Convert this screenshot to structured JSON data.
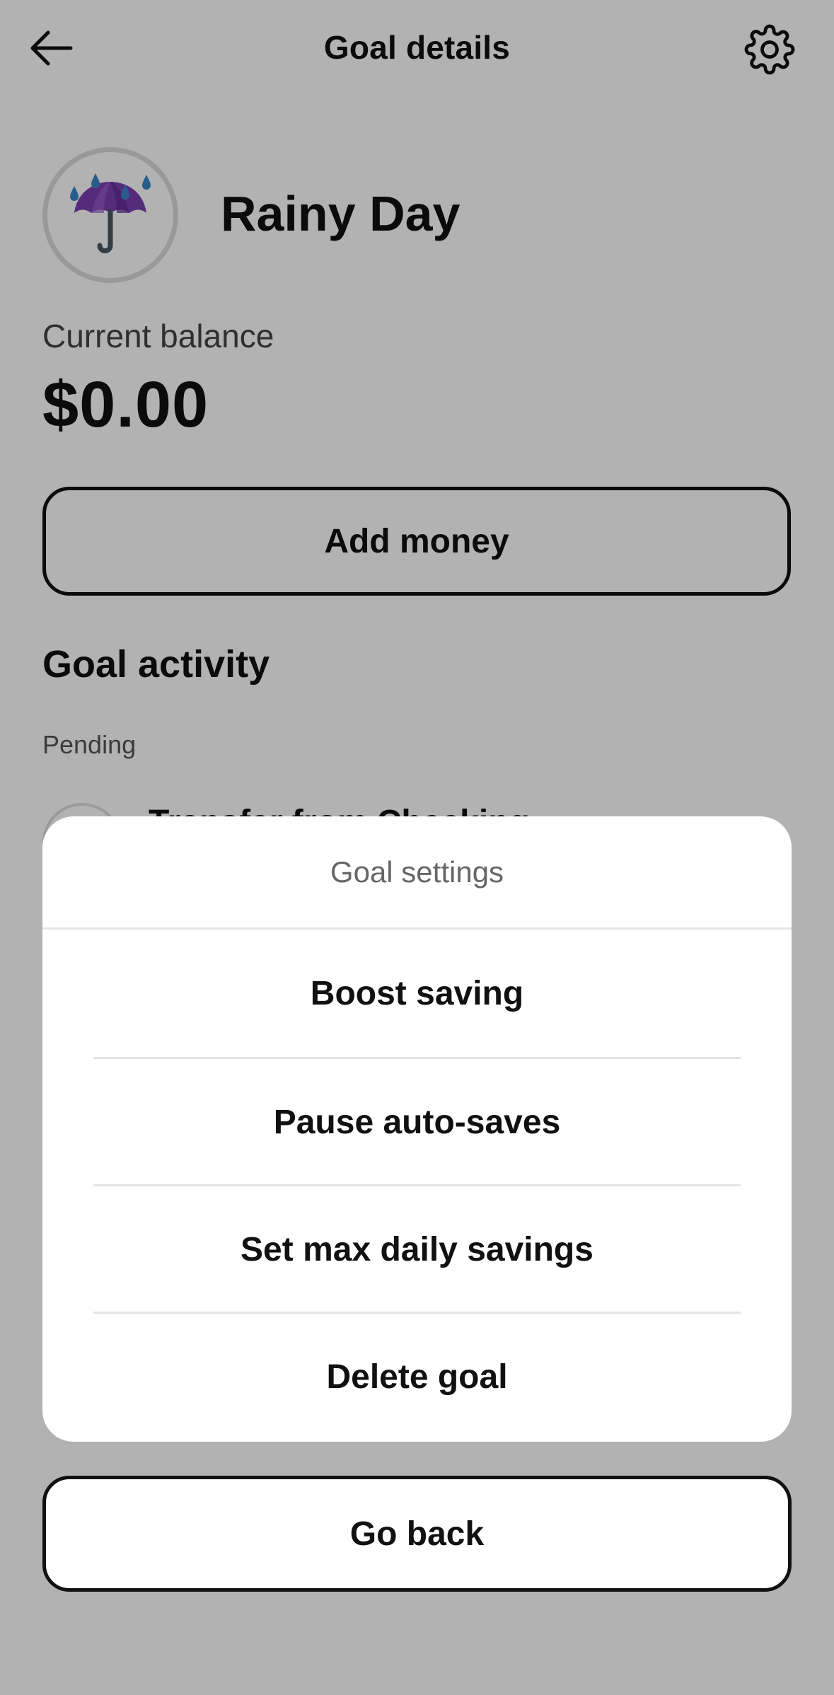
{
  "header": {
    "title": "Goal details",
    "back_icon": "arrow-left-icon",
    "settings_icon": "gear-icon"
  },
  "goal": {
    "name": "Rainy Day",
    "icon": "umbrella-rain-icon",
    "balance_label": "Current balance",
    "balance_value": "$0.00",
    "add_money_label": "Add money"
  },
  "activity": {
    "title": "Goal activity",
    "pending_label": "Pending",
    "items": [
      {
        "label": "Transfer from Checking"
      }
    ]
  },
  "sheet": {
    "title": "Goal settings",
    "items": [
      {
        "label": "Boost saving"
      },
      {
        "label": "Pause auto-saves"
      },
      {
        "label": "Set max daily savings"
      },
      {
        "label": "Delete goal"
      }
    ],
    "go_back_label": "Go back"
  },
  "colors": {
    "overlay": "#b3b3b3",
    "umbrella": "#7a3fb0",
    "raindrop": "#3a86c8"
  }
}
